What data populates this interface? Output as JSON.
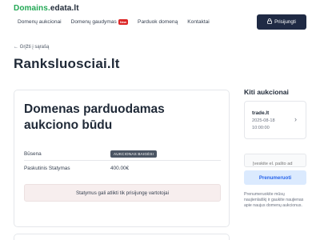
{
  "header": {
    "logo": {
      "part1": "Domains",
      "part2": ".",
      "part3": "edata.lt"
    },
    "nav": [
      {
        "label": "Domenų aukcionai"
      },
      {
        "label": "Domenų gaudymas",
        "badge": "New"
      },
      {
        "label": "Parduok domeną"
      },
      {
        "label": "Kontaktai"
      }
    ],
    "login_label": "Prisijungti",
    "login_icon": "lock-icon"
  },
  "back_link": "← Grįžti į sąrašą",
  "domain_title": "Ranksluosciai.lt",
  "main_card": {
    "heading": "Domenas parduodamas aukciono būdu",
    "status_label": "Būsena",
    "status_value": "AUKCIONAS BAIGĖSI",
    "bid_label": "Paskutinis Statymas",
    "bid_value": "400.00€",
    "notice": "Statymus gali atlikti tik prisijungę vartotojai"
  },
  "sidebar": {
    "title": "Kiti aukcionai",
    "auction": {
      "domain": "trade.lt",
      "date": "2025-08-18 10:00:00"
    },
    "email_placeholder": "Įveskite el. pašto ad",
    "subscribe_label": "Prenumeruoti",
    "note": "Prenumeruokite mūsų naujienlaiškį ir gaukite naujienas apie naujus domenų aukcionus."
  },
  "colors": {
    "brand_green": "#22a855",
    "login_bg": "#1f2a44",
    "subscribe_bg": "#dbeafe",
    "subscribe_text": "#2563eb"
  }
}
